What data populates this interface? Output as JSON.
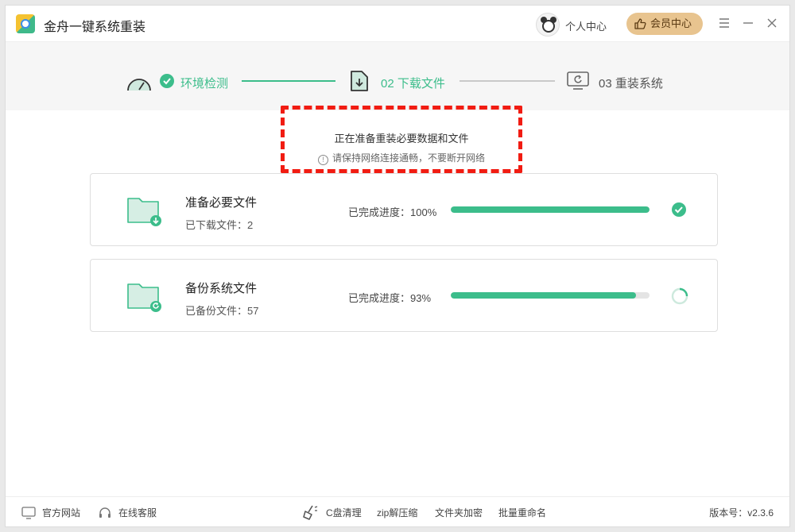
{
  "app": {
    "title": "金舟一键系统重装"
  },
  "header": {
    "personal_center": "个人中心",
    "vip_center": "会员中心"
  },
  "steps": [
    {
      "label": "环境检测",
      "state": "done"
    },
    {
      "label": "02 下载文件",
      "state": "active"
    },
    {
      "label": "03 重装系统",
      "state": "pending"
    }
  ],
  "notice": {
    "main": "正在准备重装必要数据和文件",
    "sub": "请保持网络连接通畅，不要断开网络",
    "info_glyph": "!"
  },
  "tasks": [
    {
      "title": "准备必要文件",
      "count_label": "已下载文件：2",
      "progress_label": "已完成进度：100%",
      "progress": 100,
      "status": "complete"
    },
    {
      "title": "备份系统文件",
      "count_label": "已备份文件：57",
      "progress_label": "已完成进度：93%",
      "progress": 93,
      "status": "loading"
    }
  ],
  "footer": {
    "official_site": "官方网站",
    "online_service": "在线客服",
    "tools": [
      "C盘清理",
      "zip解压缩",
      "文件夹加密",
      "批量重命名"
    ],
    "version": "版本号：v2.3.6"
  },
  "colors": {
    "accent": "#3cbd8b",
    "vip": "#e8c48f",
    "highlight": "#f11c12",
    "pending": "#555555"
  }
}
